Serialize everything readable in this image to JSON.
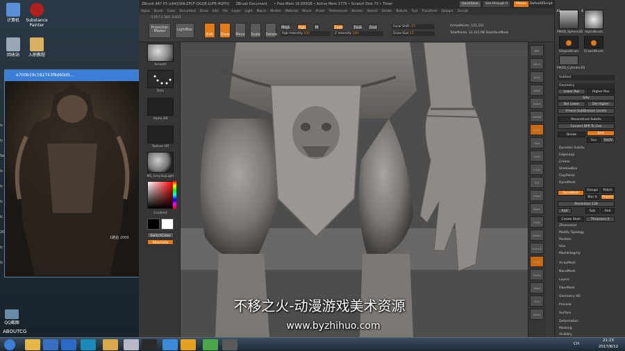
{
  "desktop": {
    "icons": [
      {
        "label": "计算机",
        "color": "#5a8fd6"
      },
      {
        "label": "Substance Painter",
        "color": "#b02020"
      },
      {
        "label": "回收站",
        "color": "#9aa8b5"
      },
      {
        "label": "入职教程",
        "color": "#d8b060"
      },
      {
        "label": "QQ截图",
        "color": "#6a8aa6"
      },
      {
        "label": "ABOUTCG",
        "color": "#444"
      }
    ],
    "side_labels": [
      "Ic",
      "Ic",
      "Se",
      "Ic",
      "Ic",
      "Ic",
      "Ic",
      "20",
      "Ic",
      "Ic"
    ]
  },
  "viewer": {
    "title": "e700b19c182743f8d60d0...",
    "overlay_text": "1路拍 2009"
  },
  "zbrush": {
    "title_items": [
      "ZBrush 4R7 P3 (x64)[SIN-ZPCF-QGQE-LUFE-HQFH]",
      "ZBrush Document",
      "• Free Mem 18.093GB • Active Mem 1779 • Scratch Disk 73 • Timer"
    ],
    "title_right": [
      "QuickSave",
      "See-through 0",
      "Menus",
      "DefaultZScript"
    ],
    "menu": [
      "Alpha",
      "Brush",
      "Color",
      "Document",
      "Draw",
      "Edit",
      "File",
      "Layer",
      "Light",
      "Macro",
      "Marker",
      "Material",
      "Movie",
      "Picker",
      "Preferences",
      "Render",
      "Stencil",
      "Stroke",
      "Texture",
      "Tool",
      "Transform",
      "Zplugin",
      "Zscript"
    ],
    "coords": "-1.057,1.583,-0.815",
    "toolbar": {
      "projection_master": "Projection Master",
      "lightbox": "LightBox",
      "edit": "Edit",
      "draw": "Draw",
      "move": "Move",
      "scale": "Scale",
      "rotate": "Rotate"
    },
    "sliders": [
      {
        "label": "Mrgb",
        "value": ""
      },
      {
        "label": "Rgb",
        "value": ""
      },
      {
        "label": "M",
        "value": ""
      },
      {
        "label": "Zadd",
        "value": ""
      },
      {
        "label": "Zsub",
        "value": ""
      },
      {
        "label": "Zcut",
        "value": ""
      },
      {
        "label": "Rgb Intensity",
        "value": "100"
      },
      {
        "label": "Z Intensity",
        "value": "100"
      },
      {
        "label": "Focal Shift",
        "value": "-55"
      },
      {
        "label": "Draw Size",
        "value": "17"
      },
      {
        "label": "ActivePoints:",
        "value": "121,221"
      },
      {
        "label": "TotalPoints:",
        "value": "12.221 Mil"
      },
      {
        "label": "BackfaceMask",
        "value": ""
      }
    ],
    "left_shelf": [
      {
        "label": "Smooth"
      },
      {
        "label": "Dots"
      },
      {
        "label": "Alpha Off"
      },
      {
        "label": "Texture Off"
      },
      {
        "label": "MS_GreySkyLight"
      },
      {
        "label": "Gradient"
      },
      {
        "label": "SwitchColor"
      },
      {
        "label": "Alternate"
      }
    ],
    "right_shelf": [
      "BPR",
      "SPix 3",
      "Scroll",
      "Zoom",
      "Actual",
      "AAHalf",
      "Persp",
      "Floor",
      "Local",
      "L.Sym",
      "XYZ",
      "Frame",
      "Move",
      "Scale",
      "Rotate",
      "Line Fill",
      "PolyF",
      "Transp",
      "Ghost",
      "Solo",
      "Xpose"
    ],
    "tray": {
      "swatch_labels": [
        "PM3D_Sphere3D",
        "AlphaBrush",
        "SimpleBrush",
        "EraserBrush",
        "PM3D_Cylinder3D"
      ],
      "counts": [
        "33",
        "4"
      ],
      "items": [
        {
          "label": "Subtool",
          "style": "hd"
        },
        {
          "label": "Geometry",
          "style": "hd"
        },
        {
          "label": "Lower Res",
          "style": "btn"
        },
        {
          "label": "Higher Res",
          "style": "btn"
        },
        {
          "label": "Sdiv",
          "style": "bar"
        },
        {
          "label": "Del Lower",
          "style": "btn"
        },
        {
          "label": "Del Higher",
          "style": "btn"
        },
        {
          "label": "Freeze SubDivision Levels",
          "style": "bar"
        },
        {
          "label": "Reconstruct Subdiv",
          "style": "btn"
        },
        {
          "label": "Convert BPR To Geo",
          "style": "bar"
        },
        {
          "label": "Divide",
          "style": "btn"
        },
        {
          "label": "Smt",
          "style": "or"
        },
        {
          "label": "Suv",
          "style": "btn"
        },
        {
          "label": "ReUV",
          "style": "btn"
        },
        {
          "label": "Dynamic Subdiv",
          "style": "row"
        },
        {
          "label": "EdgeLoop",
          "style": "row"
        },
        {
          "label": "Crease",
          "style": "row"
        },
        {
          "label": "ShadowBox",
          "style": "row"
        },
        {
          "label": "ClayPolish",
          "style": "row"
        },
        {
          "label": "DynaMesh",
          "style": "row"
        },
        {
          "label": "DynaMesh",
          "style": "or"
        },
        {
          "label": "Groups",
          "style": "btn"
        },
        {
          "label": "Polish",
          "style": "btn"
        },
        {
          "label": "Blur 0",
          "style": "btn"
        },
        {
          "label": "Project",
          "style": "or"
        },
        {
          "label": "Resolution 128",
          "style": "bar"
        },
        {
          "label": "Add",
          "style": "btn"
        },
        {
          "label": "Sub",
          "style": "btn"
        },
        {
          "label": "And",
          "style": "btn"
        },
        {
          "label": "Create Shell",
          "style": "btn"
        },
        {
          "label": "Thickness 4",
          "style": "bar"
        },
        {
          "label": "ZRemesher",
          "style": "row"
        },
        {
          "label": "Modify Topology",
          "style": "row"
        },
        {
          "label": "Position",
          "style": "row"
        },
        {
          "label": "Size",
          "style": "row"
        },
        {
          "label": "MeshIntegrity",
          "style": "row"
        },
        {
          "label": "ArrayMesh",
          "style": "row"
        },
        {
          "label": "NanoMesh",
          "style": "row"
        },
        {
          "label": "Layers",
          "style": "row"
        },
        {
          "label": "FiberMesh",
          "style": "row"
        },
        {
          "label": "Geometry HD",
          "style": "row"
        },
        {
          "label": "Preview",
          "style": "row"
        },
        {
          "label": "Surface",
          "style": "row"
        },
        {
          "label": "Deformation",
          "style": "row"
        },
        {
          "label": "Masking",
          "style": "row"
        },
        {
          "label": "Visibility",
          "style": "row"
        }
      ]
    }
  },
  "watermark": {
    "line1": "不移之火-动漫游戏美术资源",
    "line2": "www.byzhihuo.com"
  },
  "taskbar": {
    "apps": [
      {
        "name": "start",
        "color": "#3a7fd6"
      },
      {
        "name": "explorer",
        "color": "#e6b84a"
      },
      {
        "name": "media",
        "color": "#3a6fc0"
      },
      {
        "name": "k-app",
        "color": "#2a6ac8"
      },
      {
        "name": "maya",
        "color": "#1a8ab8"
      },
      {
        "name": "folder",
        "color": "#d8a84a"
      },
      {
        "name": "image",
        "color": "#b8b8c8"
      },
      {
        "name": "zbrush",
        "color": "#2a2a2a"
      },
      {
        "name": "remote",
        "color": "#3a8ad8"
      },
      {
        "name": "m-app",
        "color": "#e8a020"
      },
      {
        "name": "chrome",
        "color": "#4aa84a"
      },
      {
        "name": "obs",
        "color": "#5a5a5a"
      }
    ],
    "lang": "CH",
    "time": "21:23",
    "date": "2017/8/12"
  }
}
